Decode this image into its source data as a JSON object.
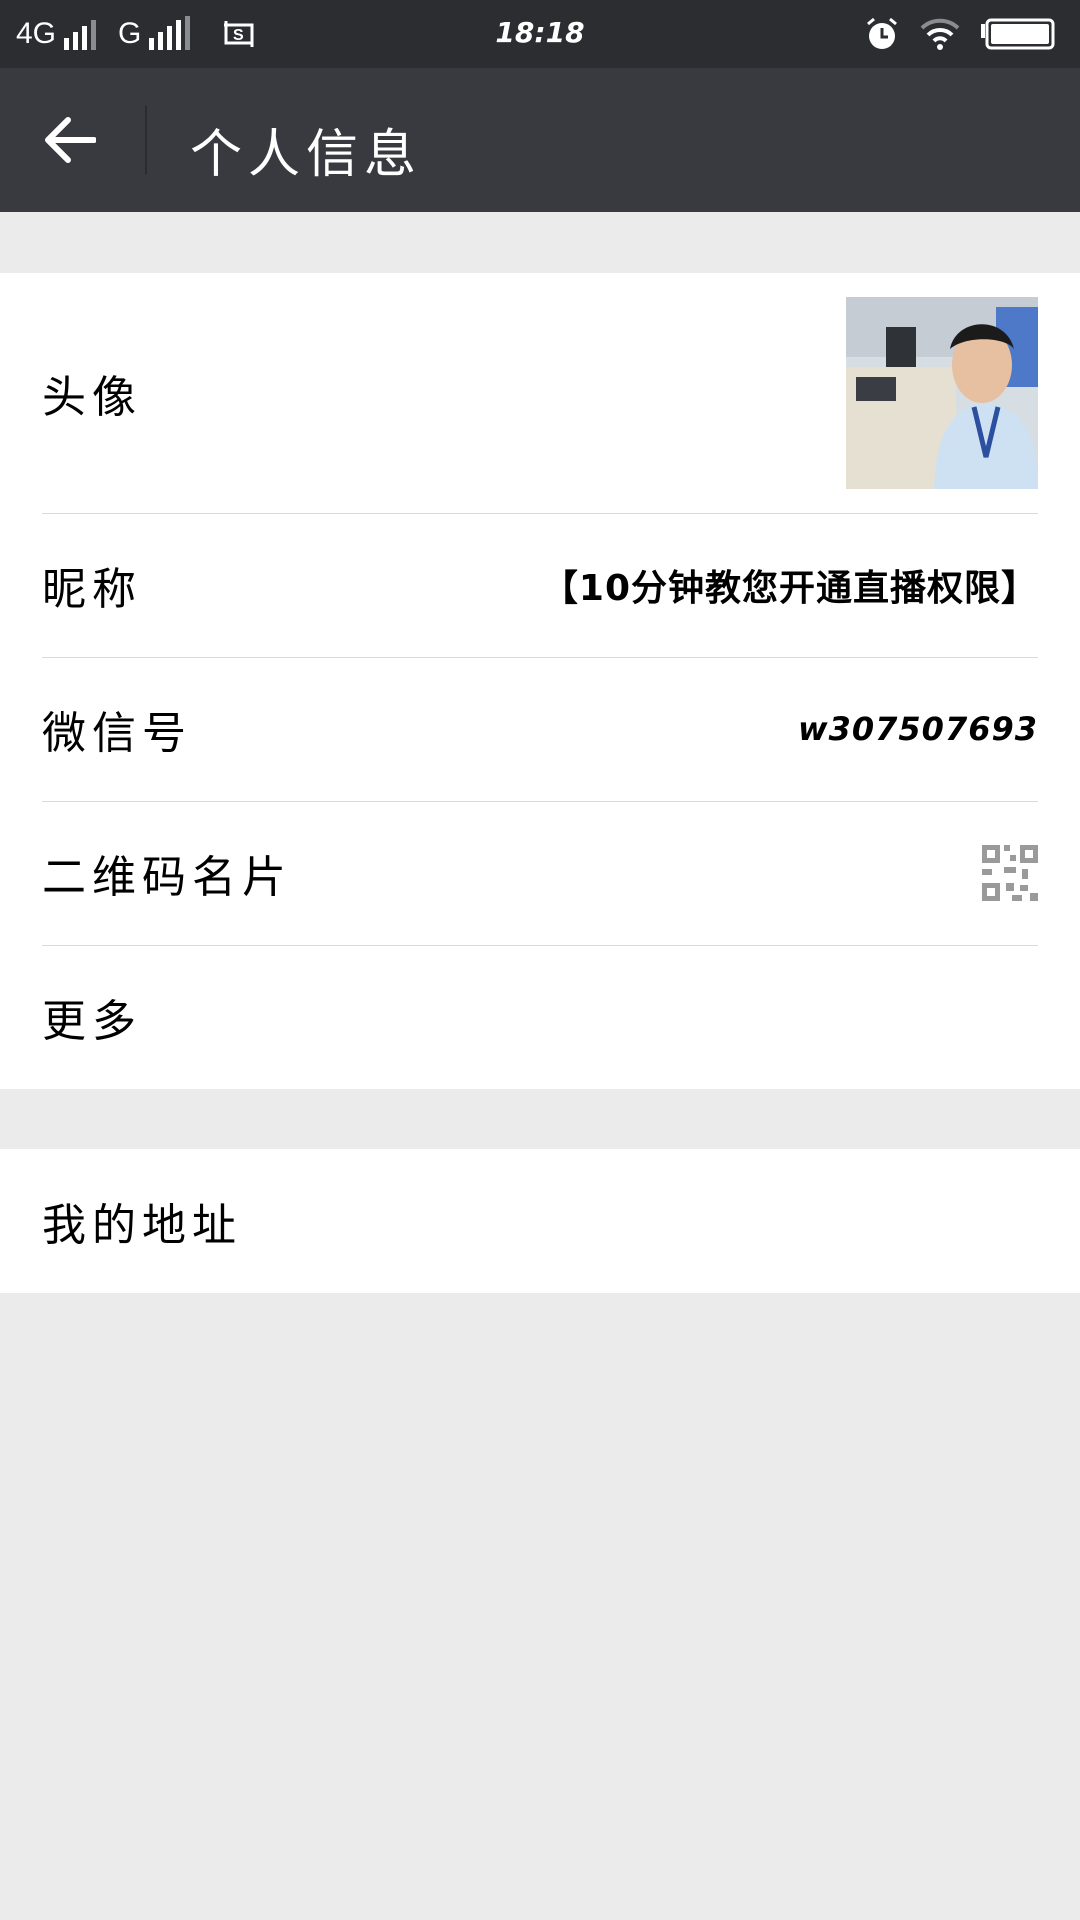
{
  "status_bar": {
    "network_1": "4G",
    "network_2": "G",
    "time": "18:18"
  },
  "header": {
    "title": "个人信息"
  },
  "profile": {
    "avatar_label": "头像",
    "nickname_label": "昵称",
    "nickname_value": "【10分钟教您开通直播权限】",
    "wechat_id_label": "微信号",
    "wechat_id_value": "w307507693",
    "qr_card_label": "二维码名片",
    "more_label": "更多"
  },
  "address": {
    "label": "我的地址"
  },
  "icons": {
    "back": "arrow-left-icon",
    "qr": "qr-code-icon",
    "alarm": "alarm-icon",
    "wifi": "wifi-icon",
    "battery": "battery-icon",
    "screenshot": "screenshot-icon"
  },
  "colors": {
    "status_bar": "#2b2d31",
    "title_bar": "#393a3f",
    "background": "#ebebeb"
  }
}
